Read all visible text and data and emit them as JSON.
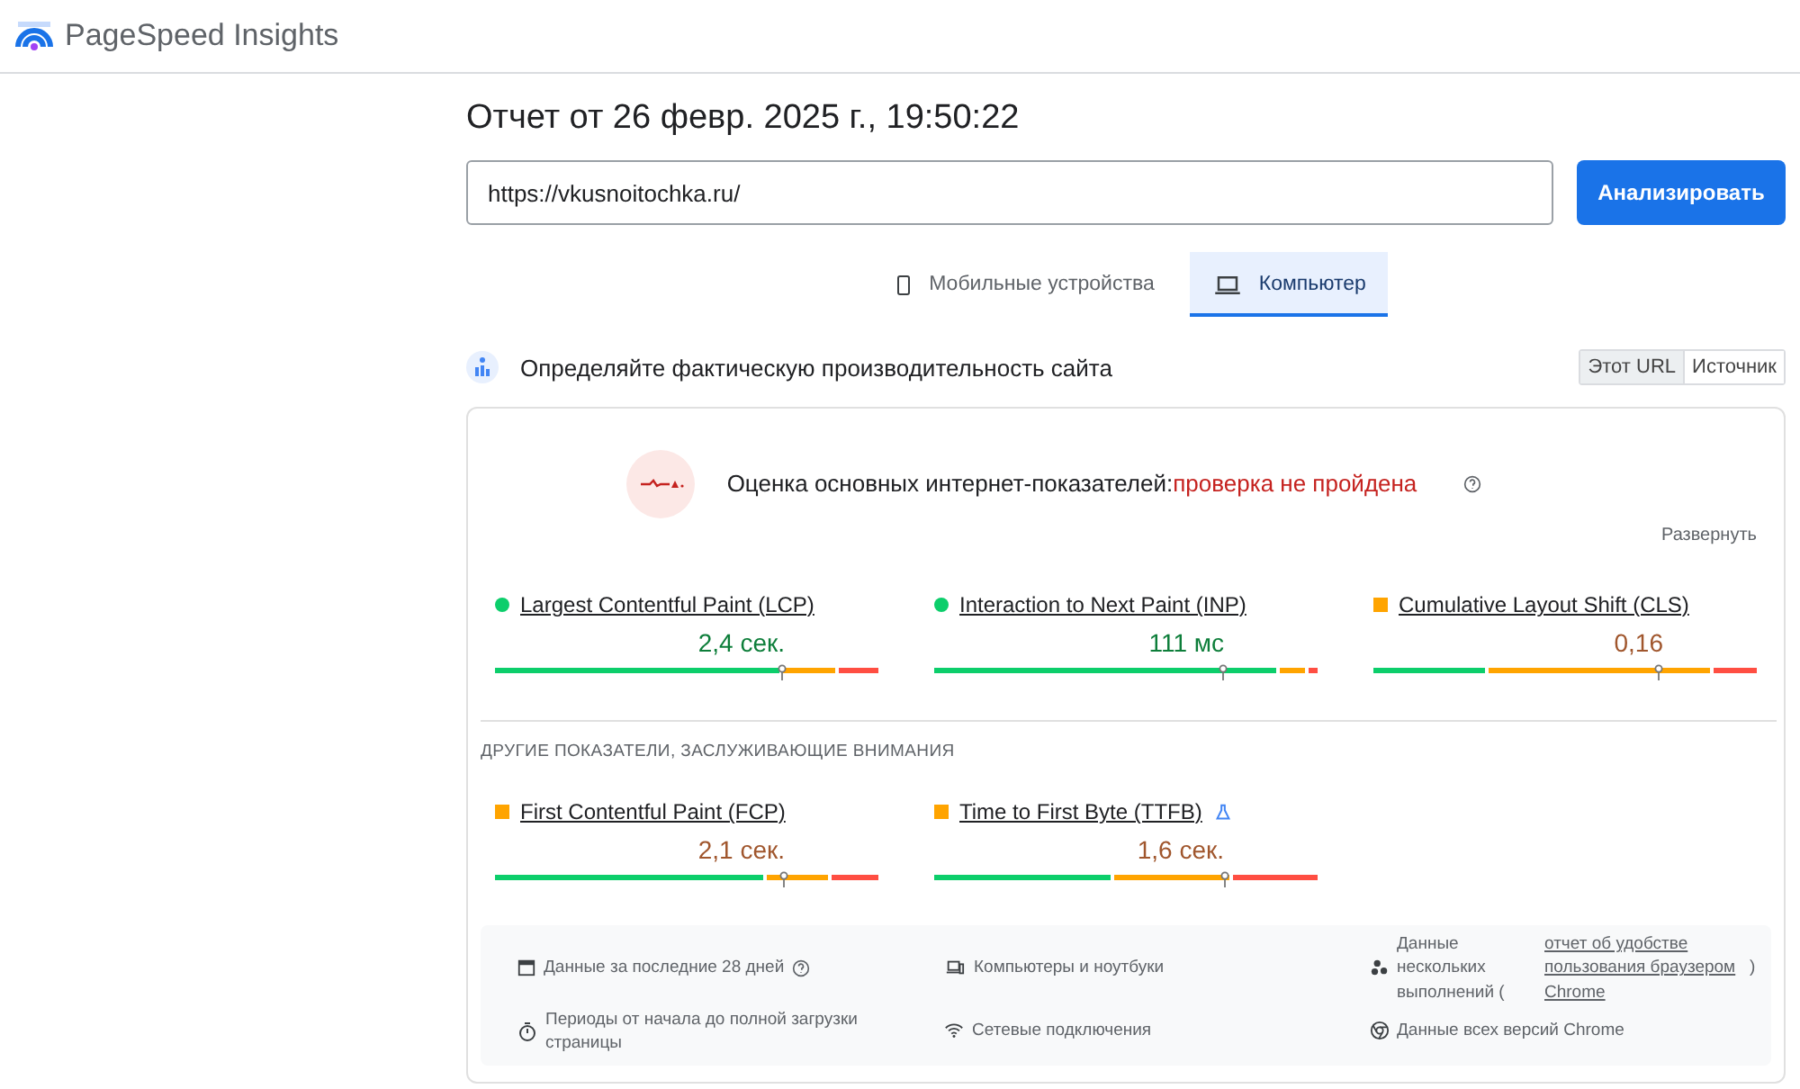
{
  "header": {
    "title": "PageSpeed Insights"
  },
  "report_title": "Отчет от 26 февр. 2025 г., 19:50:22",
  "url_field": {
    "value": "https://vkusnoitochka.ru/"
  },
  "analyze_button": "Анализировать",
  "device_tabs": [
    {
      "kind": "mobile",
      "label": "Мобильные устройства",
      "selected": false
    },
    {
      "kind": "desktop",
      "label": "Компьютер",
      "selected": true
    }
  ],
  "section": {
    "title": "Определяйте фактическую производительность сайта",
    "toggles": [
      {
        "label": "Этот URL",
        "selected": true
      },
      {
        "label": "Источник",
        "selected": false
      }
    ]
  },
  "assessment": {
    "label": "Оценка основных интернет-показателей:",
    "result": "проверка не пройдена",
    "passed": false,
    "expand": "Развернуть"
  },
  "core_metrics": [
    {
      "name": "Largest Contentful Paint (LCP)",
      "value": "2,4 сек.",
      "kind": "good"
    },
    {
      "name": "Interaction to Next Paint (INP)",
      "value": "111 мс",
      "kind": "good"
    },
    {
      "name": "Cumulative Layout Shift (CLS)",
      "value": "0,16",
      "kind": "average"
    }
  ],
  "other_heading": "ДРУГИЕ ПОКАЗАТЕЛИ, ЗАСЛУЖИВАЮЩИЕ ВНИМАНИЯ",
  "other_metrics": [
    {
      "name": "First Contentful Paint (FCP)",
      "value": "2,1 сек.",
      "kind": "average",
      "experimental": false
    },
    {
      "name": "Time to First Byte (TTFB)",
      "value": "1,6 сек.",
      "kind": "average",
      "experimental": true
    }
  ],
  "info": [
    {
      "kind": "calendar",
      "text": "Данные за последние 28 дней",
      "help": true
    },
    {
      "kind": "devices",
      "text": "Компьютеры и ноутбуки",
      "help": false
    },
    {
      "kind": "samples",
      "text": "Данные нескольких выполнений (",
      "link": "отчет об удобстве пользования браузером Chrome",
      "after": ")",
      "help": false
    },
    {
      "kind": "timer",
      "text": "Периоды от начала до полной загрузки страницы",
      "help": false
    },
    {
      "kind": "network",
      "text": "Сетевые подключения",
      "help": false
    },
    {
      "kind": "chrome",
      "text": "Данные всех версий Chrome",
      "help": false
    }
  ]
}
